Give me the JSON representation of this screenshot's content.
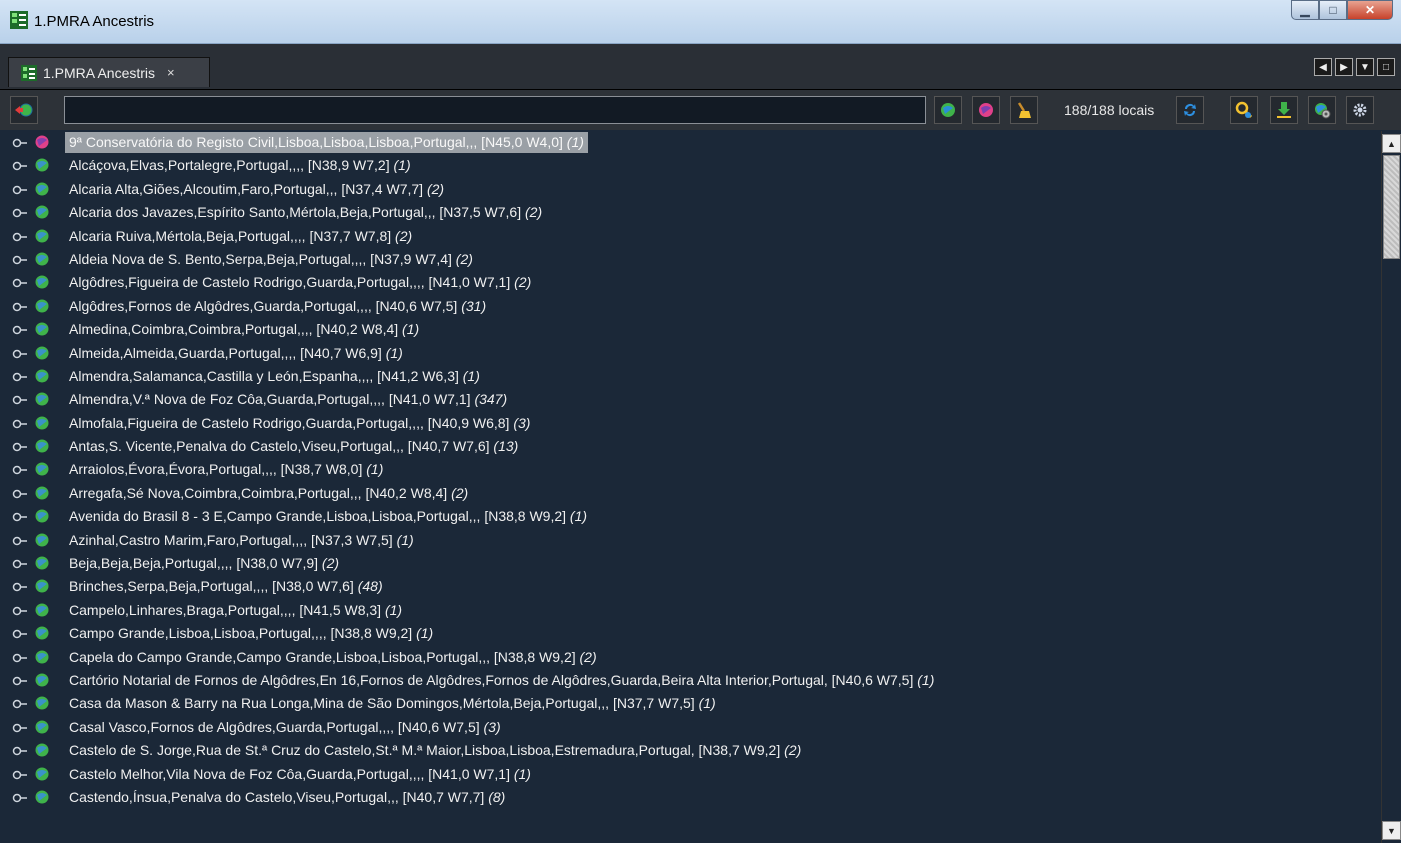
{
  "window": {
    "title": "1.PMRA Ancestris"
  },
  "tab": {
    "label": "1.PMRA Ancestris",
    "close": "×"
  },
  "toolbar": {
    "search_value": "",
    "count_text": "188/188 locais"
  },
  "colors": {
    "pink_globe": "#e0408a",
    "green_globe": "#3fb34a",
    "blue_globe": "#3a8fd6",
    "selection": "#9aa0a6"
  },
  "places": [
    {
      "name": "9ª Conservatória do Registo Civil,Lisboa,Lisboa,Lisboa,Portugal,,, [N45,0 W4,0]",
      "count": "(1)",
      "icon": "pink-globe",
      "selected": true
    },
    {
      "name": "Alcáçova,Elvas,Portalegre,Portugal,,,, [N38,9 W7,2]",
      "count": "(1)",
      "icon": "green-globe"
    },
    {
      "name": "Alcaria Alta,Giões,Alcoutim,Faro,Portugal,,, [N37,4 W7,7]",
      "count": "(2)",
      "icon": "green-globe"
    },
    {
      "name": "Alcaria dos Javazes,Espírito Santo,Mértola,Beja,Portugal,,, [N37,5 W7,6]",
      "count": "(2)",
      "icon": "green-globe"
    },
    {
      "name": "Alcaria Ruiva,Mértola,Beja,Portugal,,,, [N37,7 W7,8]",
      "count": "(2)",
      "icon": "green-globe"
    },
    {
      "name": "Aldeia Nova de S. Bento,Serpa,Beja,Portugal,,,, [N37,9 W7,4]",
      "count": "(2)",
      "icon": "green-globe"
    },
    {
      "name": "Algôdres,Figueira de Castelo Rodrigo,Guarda,Portugal,,,, [N41,0 W7,1]",
      "count": "(2)",
      "icon": "green-globe"
    },
    {
      "name": "Algôdres,Fornos de Algôdres,Guarda,Portugal,,,, [N40,6 W7,5]",
      "count": "(31)",
      "icon": "green-globe"
    },
    {
      "name": "Almedina,Coimbra,Coimbra,Portugal,,,, [N40,2 W8,4]",
      "count": "(1)",
      "icon": "green-globe"
    },
    {
      "name": "Almeida,Almeida,Guarda,Portugal,,,, [N40,7 W6,9]",
      "count": "(1)",
      "icon": "green-globe"
    },
    {
      "name": "Almendra,Salamanca,Castilla y León,Espanha,,,, [N41,2 W6,3]",
      "count": "(1)",
      "icon": "green-globe"
    },
    {
      "name": "Almendra,V.ª Nova de Foz Côa,Guarda,Portugal,,,, [N41,0 W7,1]",
      "count": "(347)",
      "icon": "green-globe"
    },
    {
      "name": "Almofala,Figueira de Castelo Rodrigo,Guarda,Portugal,,,, [N40,9 W6,8]",
      "count": "(3)",
      "icon": "green-globe"
    },
    {
      "name": "Antas,S. Vicente,Penalva do Castelo,Viseu,Portugal,,, [N40,7 W7,6]",
      "count": "(13)",
      "icon": "green-globe"
    },
    {
      "name": "Arraiolos,Évora,Évora,Portugal,,,, [N38,7 W8,0]",
      "count": "(1)",
      "icon": "green-globe"
    },
    {
      "name": "Arregafa,Sé Nova,Coimbra,Coimbra,Portugal,,, [N40,2 W8,4]",
      "count": "(2)",
      "icon": "green-globe"
    },
    {
      "name": "Avenida do Brasil 8 - 3 E,Campo Grande,Lisboa,Lisboa,Portugal,,, [N38,8 W9,2]",
      "count": "(1)",
      "icon": "green-globe"
    },
    {
      "name": "Azinhal,Castro Marim,Faro,Portugal,,,, [N37,3 W7,5]",
      "count": "(1)",
      "icon": "green-globe"
    },
    {
      "name": "Beja,Beja,Beja,Portugal,,,, [N38,0 W7,9]",
      "count": "(2)",
      "icon": "green-globe"
    },
    {
      "name": "Brinches,Serpa,Beja,Portugal,,,, [N38,0 W7,6]",
      "count": "(48)",
      "icon": "green-globe"
    },
    {
      "name": "Campelo,Linhares,Braga,Portugal,,,, [N41,5 W8,3]",
      "count": "(1)",
      "icon": "green-globe"
    },
    {
      "name": "Campo Grande,Lisboa,Lisboa,Portugal,,,, [N38,8 W9,2]",
      "count": "(1)",
      "icon": "green-globe"
    },
    {
      "name": "Capela do Campo Grande,Campo Grande,Lisboa,Lisboa,Portugal,,, [N38,8 W9,2]",
      "count": "(2)",
      "icon": "green-globe"
    },
    {
      "name": "Cartório Notarial de Fornos de Algôdres,En 16,Fornos de Algôdres,Fornos de Algôdres,Guarda,Beira Alta Interior,Portugal, [N40,6 W7,5]",
      "count": "(1)",
      "icon": "green-globe"
    },
    {
      "name": "Casa da Mason & Barry na Rua Longa,Mina de São Domingos,Mértola,Beja,Portugal,,, [N37,7 W7,5]",
      "count": "(1)",
      "icon": "green-globe"
    },
    {
      "name": "Casal Vasco,Fornos de Algôdres,Guarda,Portugal,,,, [N40,6 W7,5]",
      "count": "(3)",
      "icon": "green-globe"
    },
    {
      "name": "Castelo de S. Jorge,Rua de St.ª Cruz do Castelo,St.ª M.ª Maior,Lisboa,Lisboa,Estremadura,Portugal, [N38,7 W9,2]",
      "count": "(2)",
      "icon": "green-globe"
    },
    {
      "name": "Castelo Melhor,Vila Nova de Foz Côa,Guarda,Portugal,,,, [N41,0 W7,1]",
      "count": "(1)",
      "icon": "green-globe"
    },
    {
      "name": "Castendo,Ínsua,Penalva do Castelo,Viseu,Portugal,,, [N40,7 W7,7]",
      "count": "(8)",
      "icon": "green-globe"
    }
  ]
}
